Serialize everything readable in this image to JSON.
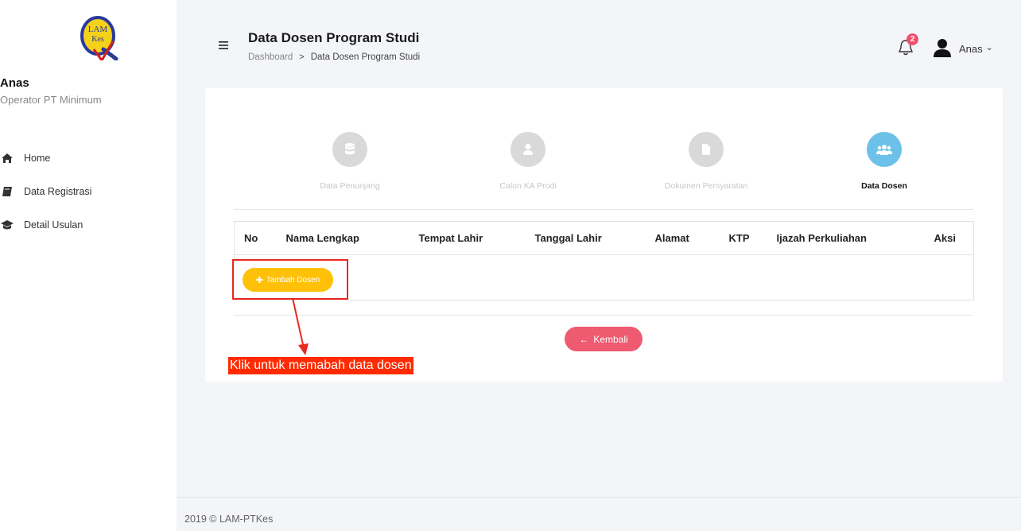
{
  "sidebar": {
    "logo_text": "LAM Kes",
    "user_name": "Anas",
    "user_role": "Operator PT Minimum",
    "items": [
      {
        "label": "Home",
        "icon": "home-icon"
      },
      {
        "label": "Data Registrasi",
        "icon": "book-icon"
      },
      {
        "label": "Detail Usulan",
        "icon": "graduation-cap-icon"
      }
    ]
  },
  "header": {
    "title": "Data Dosen Program Studi",
    "breadcrumb": {
      "root": "Dashboard",
      "separator": ">",
      "current": "Data Dosen Program Studi"
    },
    "notification_count": "2",
    "user_name": "Anas",
    "dropdown_glyph": "⌄"
  },
  "steps": [
    {
      "label": "Data Penunjang",
      "icon": "database-icon",
      "active": false
    },
    {
      "label": "Calon KA Prodi",
      "icon": "user-icon",
      "active": false
    },
    {
      "label": "Dokumen Persyaratan",
      "icon": "file-icon",
      "active": false
    },
    {
      "label": "Data Dosen",
      "icon": "users-icon",
      "active": true
    }
  ],
  "table": {
    "columns": [
      "No",
      "Nama Lengkap",
      "Tempat Lahir",
      "Tanggal Lahir",
      "Alamat",
      "KTP",
      "Ijazah Perkuliahan",
      "Aksi"
    ]
  },
  "buttons": {
    "add_label": "Tambah Dosen",
    "add_glyph": "✚",
    "back_label": "Kembali",
    "back_glyph": "←"
  },
  "annotation": {
    "label": "Klik untuk memabah data dosen"
  },
  "footer": {
    "text": "2019 © LAM-PTKes"
  },
  "colors": {
    "add_button": "#ffc107",
    "back_button": "#ee5a6f",
    "active_step": "#6cc1e8",
    "annotation": "#ff2a00",
    "badge": "#f0506e"
  }
}
